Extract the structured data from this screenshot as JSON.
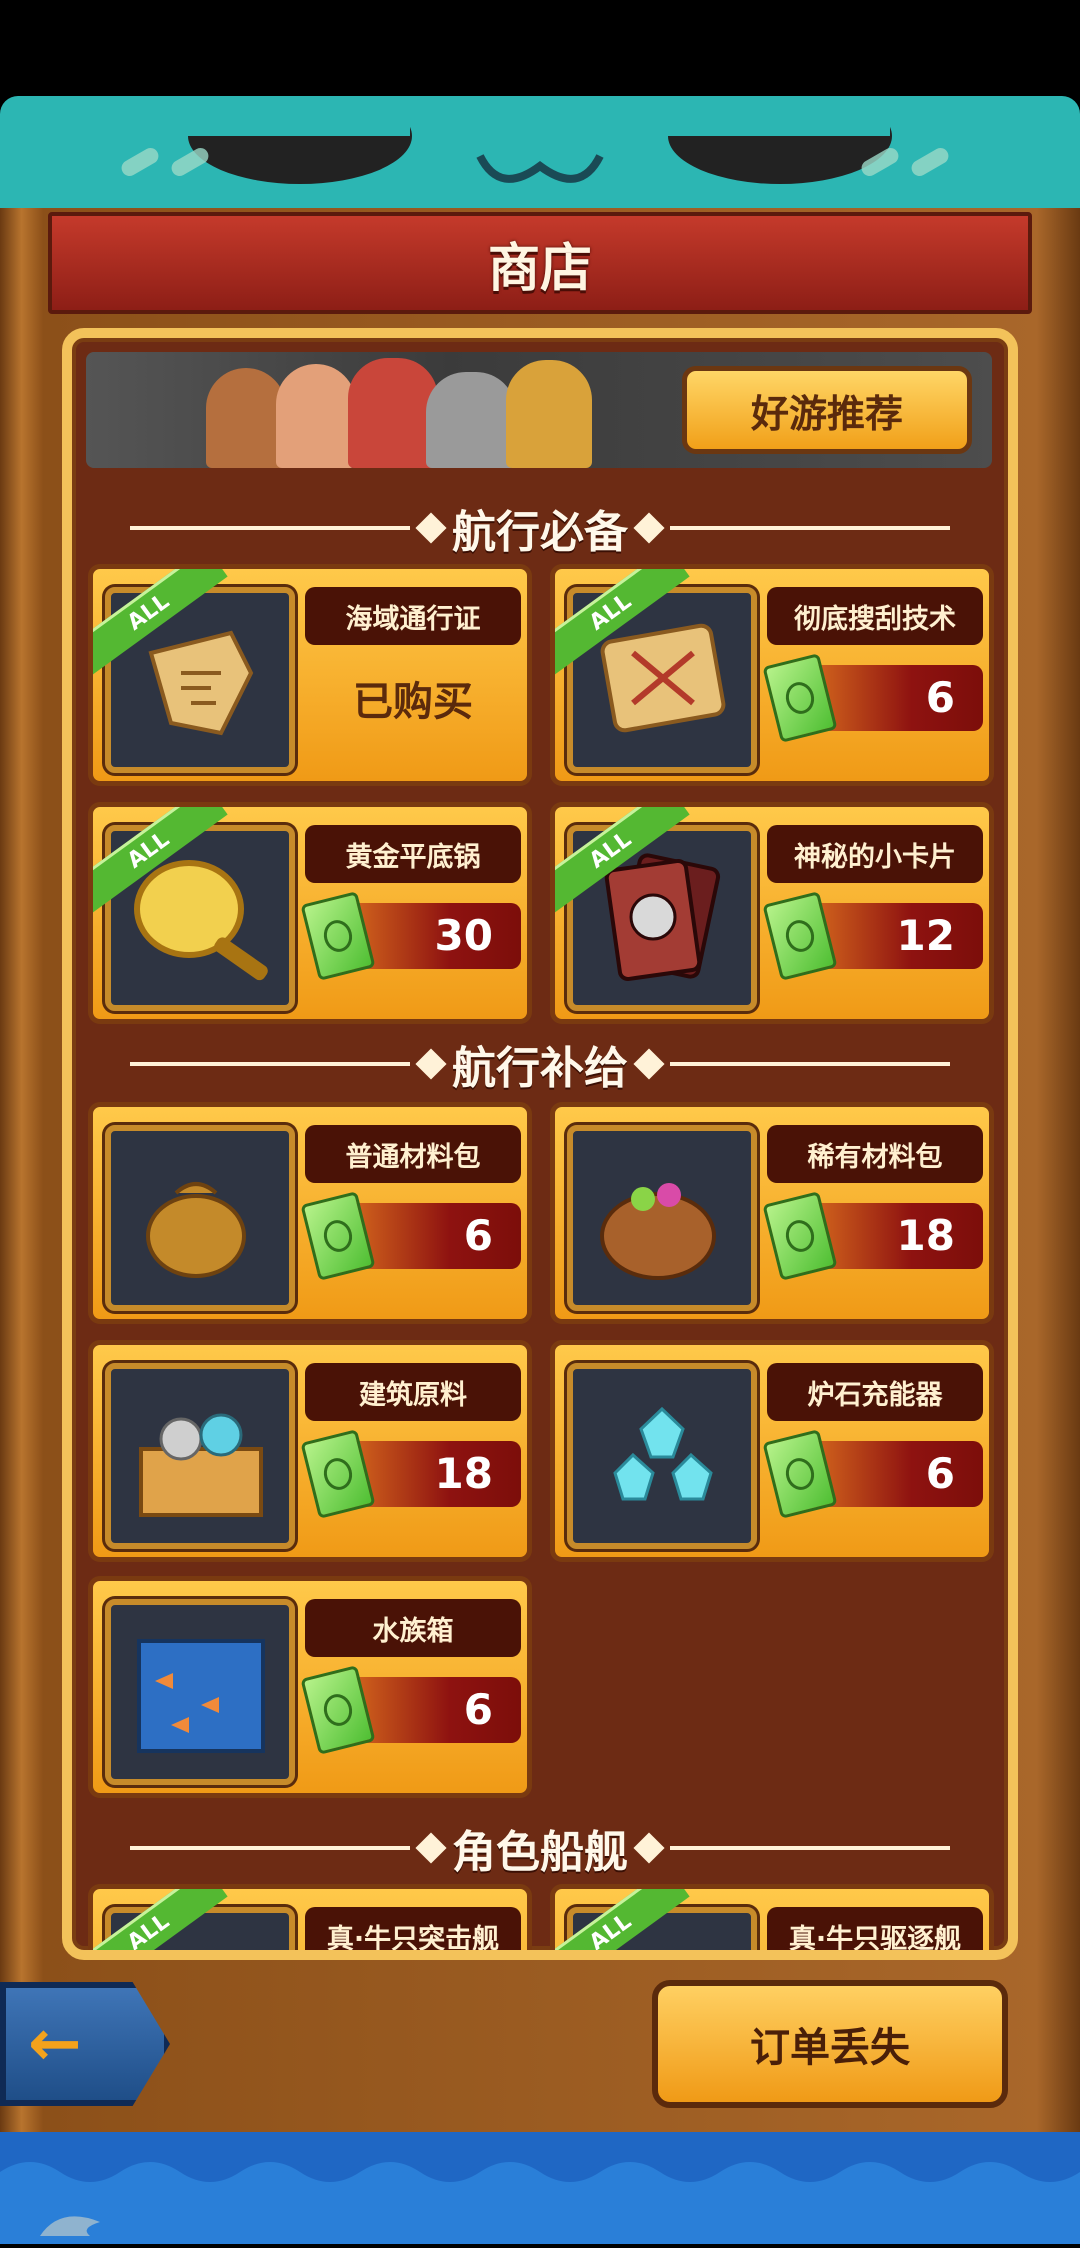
{
  "header": {
    "title": "商店"
  },
  "banner": {
    "recommend_label": "好游推荐"
  },
  "sections": [
    {
      "title": "航行必备"
    },
    {
      "title": "航行补给"
    },
    {
      "title": "角色船舰"
    }
  ],
  "items": [
    {
      "name": "海域通行证",
      "status": "已购买",
      "badge": "ALL",
      "icon": "treasure-map-icon"
    },
    {
      "name": "彻底搜刮技术",
      "price": "6",
      "badge": "ALL",
      "icon": "swords-scroll-icon"
    },
    {
      "name": "黄金平底锅",
      "price": "30",
      "badge": "ALL",
      "icon": "frying-pan-icon"
    },
    {
      "name": "神秘的小卡片",
      "price": "12",
      "badge": "ALL",
      "icon": "dragon-card-icon"
    },
    {
      "name": "普通材料包",
      "price": "6",
      "icon": "material-bag-icon"
    },
    {
      "name": "稀有材料包",
      "price": "18",
      "icon": "rare-material-bag-icon"
    },
    {
      "name": "建筑原料",
      "price": "18",
      "icon": "ore-crate-icon"
    },
    {
      "name": "炉石充能器",
      "price": "6",
      "icon": "crystal-charger-icon"
    },
    {
      "name": "水族箱",
      "price": "6",
      "icon": "aquarium-icon"
    },
    {
      "name": "真·牛只突击舰",
      "badge": "ALL",
      "icon": "ship-icon"
    },
    {
      "name": "真·牛只驱逐舰",
      "badge": "ALL",
      "icon": "ship-icon"
    }
  ],
  "footer": {
    "back_icon": "left-arrow-icon",
    "order_label": "订单丢失"
  },
  "colors": {
    "accent": "#f09a16",
    "panel": "#6d2b14",
    "header": "#c53a2b",
    "teal": "#2cb6b3"
  }
}
